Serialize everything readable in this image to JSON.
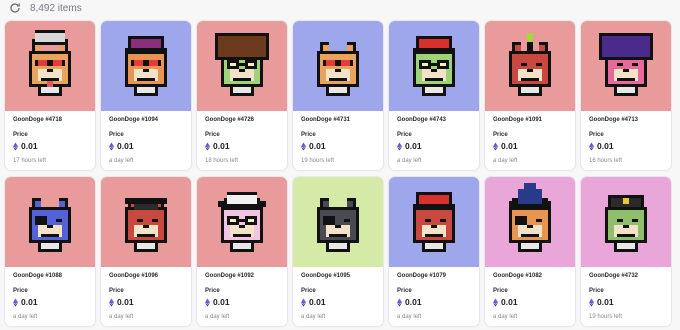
{
  "header": {
    "item_count": "8,492 items",
    "refresh_icon": "refresh-icon"
  },
  "listing": {
    "price_label": "Price",
    "currency_icon": "ethereum-icon",
    "cards": [
      {
        "name": "GoonDoge #4718",
        "price": "0.01",
        "time_left": "17 hours left",
        "bg": "#e99a9a",
        "fur": "#e9a35b",
        "hat": "wizard-white",
        "eyes": "shades",
        "tongue": true
      },
      {
        "name": "GoonDoge #1094",
        "price": "0.01",
        "time_left": "a day left",
        "bg": "#9ea6ec",
        "fur": "#e99552",
        "hat": "cap-purple",
        "eyes": "shades",
        "tongue": false
      },
      {
        "name": "GoonDoge #4726",
        "price": "0.01",
        "time_left": "18 hours left",
        "bg": "#e99a9a",
        "fur": "#9fd377",
        "hat": "afro",
        "eyes": "glasses",
        "tongue": false
      },
      {
        "name": "GoonDoge #4731",
        "price": "0.01",
        "time_left": "19 hours left",
        "bg": "#9ea6ec",
        "fur": "#e9a35b",
        "hat": "none",
        "eyes": "shades",
        "tongue": false
      },
      {
        "name": "GoonDoge #4743",
        "price": "0.01",
        "time_left": "a day left",
        "bg": "#9ea6ec",
        "fur": "#9fd377",
        "hat": "cap-red",
        "eyes": "glasses",
        "tongue": false
      },
      {
        "name": "GoonDoge #1091",
        "price": "0.01",
        "time_left": "a day left",
        "bg": "#e99a9a",
        "fur": "#c9483f",
        "hat": "mohawk",
        "eyes": "plain",
        "tongue": false
      },
      {
        "name": "GoonDoge #4713",
        "price": "0.01",
        "time_left": "16 hours left",
        "bg": "#e99a9a",
        "fur": "#e86a9a",
        "hat": "afro-purple",
        "eyes": "plain",
        "tongue": false
      },
      {
        "name": "GoonDoge #1088",
        "price": "0.01",
        "time_left": "a day left",
        "bg": "#e99a9a",
        "fur": "#5462d8",
        "hat": "none",
        "eyes": "patch",
        "tongue": false
      },
      {
        "name": "GoonDoge #1096",
        "price": "0.01",
        "time_left": "a day left",
        "bg": "#e99a9a",
        "fur": "#c9483f",
        "hat": "grad",
        "eyes": "plain",
        "tongue": false
      },
      {
        "name": "GoonDoge #1092",
        "price": "0.01",
        "time_left": "a day left",
        "bg": "#e99a9a",
        "fur": "#f1c4e2",
        "hat": "cowboy",
        "eyes": "glasses",
        "tongue": false
      },
      {
        "name": "GoonDoge #1095",
        "price": "0.01",
        "time_left": "a day left",
        "bg": "#d6eaa8",
        "fur": "#4a4a52",
        "hat": "none",
        "eyes": "patch",
        "tongue": false
      },
      {
        "name": "GoonDoge #1079",
        "price": "0.01",
        "time_left": "a day left",
        "bg": "#9ea6ec",
        "fur": "#c9483f",
        "hat": "cap-red",
        "eyes": "plain",
        "tongue": false
      },
      {
        "name": "GoonDoge #1082",
        "price": "0.01",
        "time_left": "a day left",
        "bg": "#e9a6d8",
        "fur": "#e99552",
        "hat": "wizard-blue",
        "eyes": "patch",
        "tongue": false
      },
      {
        "name": "GoonDoge #4732",
        "price": "0.01",
        "time_left": "19 hours left",
        "bg": "#e9a6d8",
        "fur": "#8fbf6a",
        "hat": "police",
        "eyes": "plain",
        "tongue": false
      }
    ]
  }
}
